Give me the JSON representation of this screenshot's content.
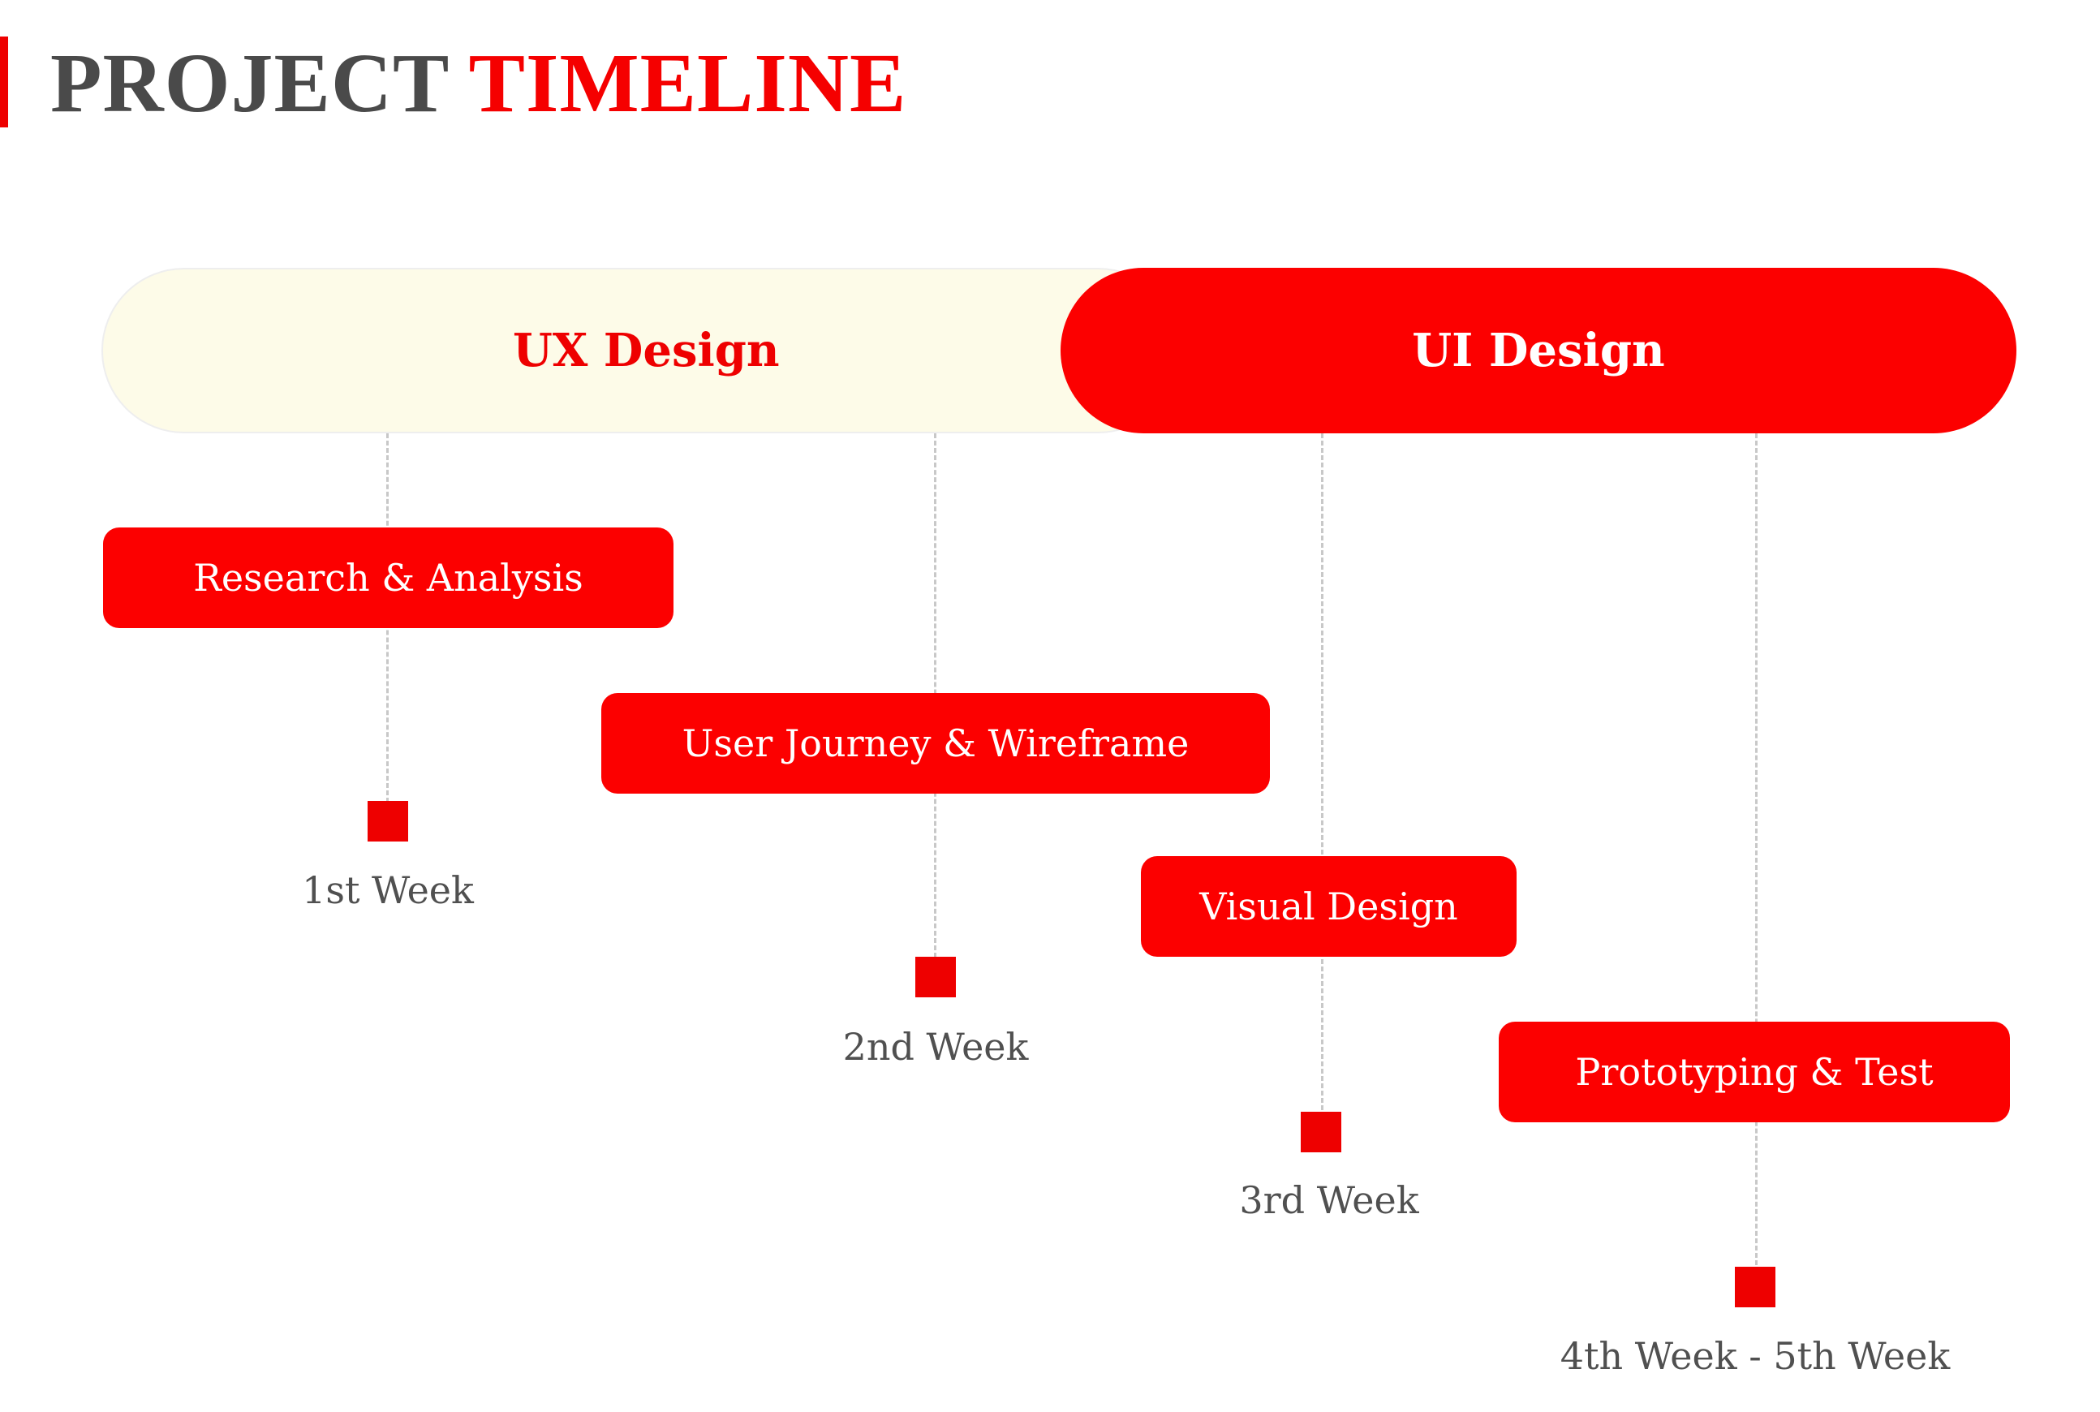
{
  "header": {
    "title_part1": "PROJECT",
    "title_part2": "TIMELINE"
  },
  "phases": [
    {
      "label": "UX Design"
    },
    {
      "label": "UI Design"
    }
  ],
  "tasks": [
    {
      "label": "Research & Analysis"
    },
    {
      "label": "User Journey & Wireframe"
    },
    {
      "label": "Visual Design"
    },
    {
      "label": "Prototyping & Test"
    }
  ],
  "milestones": [
    {
      "label": "1st Week"
    },
    {
      "label": "2nd Week"
    },
    {
      "label": "3rd Week"
    },
    {
      "label": "4th Week - 5th Week"
    }
  ],
  "colors": {
    "accent": "#fc0000",
    "ux_phase_bg": "#fdfbe8",
    "title_gray": "#4a4a4a",
    "text_gray": "#505050",
    "dash_gray": "#c8c8c8"
  }
}
